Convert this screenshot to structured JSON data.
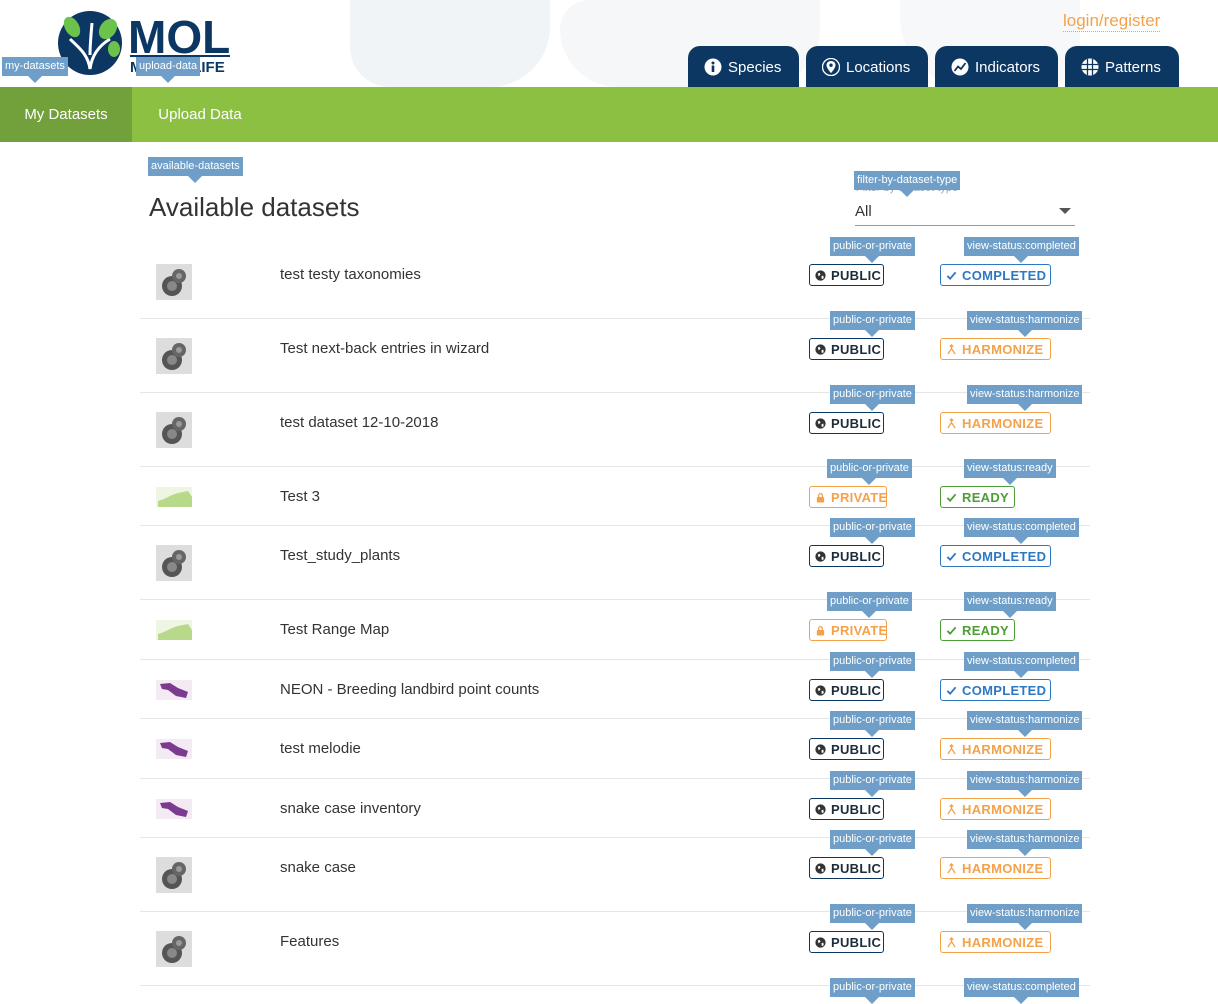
{
  "colors": {
    "nav_bg": "#0c3763",
    "green_bar": "#8cc043",
    "green_active": "#72a03a",
    "accent_orange": "#f4a24a",
    "tag_blue": "#6f9fc8"
  },
  "logo": {
    "text_top": "MOL",
    "text_bottom": "MAP OF LIFE"
  },
  "header": {
    "login_label": "login/register"
  },
  "nav": [
    {
      "label": "Species",
      "icon": "info-icon"
    },
    {
      "label": "Locations",
      "icon": "map-pin-icon"
    },
    {
      "label": "Indicators",
      "icon": "chart-icon"
    },
    {
      "label": "Patterns",
      "icon": "grid-globe-icon"
    }
  ],
  "subnav": {
    "my_datasets": "My Datasets",
    "upload_data": "Upload Data"
  },
  "tags": {
    "my_datasets": "my-datasets",
    "upload_data": "upload-data",
    "available": "available-datasets",
    "filter": "filter-by-dataset-type",
    "public_private": "public-or-private"
  },
  "page": {
    "title": "Available datasets"
  },
  "filter": {
    "label": "Filter by dataset type",
    "value": "All"
  },
  "datasets": [
    {
      "title": "test testy taxonomies",
      "thumb": "point-icon",
      "visibility": "PUBLIC",
      "status": "COMPLETED",
      "status_tag": "view-status:completed"
    },
    {
      "title": "Test next-back entries in wizard",
      "thumb": "point-icon",
      "visibility": "PUBLIC",
      "status": "HARMONIZE",
      "status_tag": "view-status:harmonize"
    },
    {
      "title": "test dataset 12-10-2018",
      "thumb": "point-icon",
      "visibility": "PUBLIC",
      "status": "HARMONIZE",
      "status_tag": "view-status:harmonize"
    },
    {
      "title": "Test 3",
      "thumb": "range-icon",
      "visibility": "PRIVATE",
      "status": "READY",
      "status_tag": "view-status:ready"
    },
    {
      "title": "Test_study_plants",
      "thumb": "point-icon",
      "visibility": "PUBLIC",
      "status": "COMPLETED",
      "status_tag": "view-status:completed"
    },
    {
      "title": "Test Range Map",
      "thumb": "range-icon",
      "visibility": "PRIVATE",
      "status": "READY",
      "status_tag": "view-status:ready"
    },
    {
      "title": "NEON - Breeding landbird point counts",
      "thumb": "inventory-icon",
      "visibility": "PUBLIC",
      "status": "COMPLETED",
      "status_tag": "view-status:completed"
    },
    {
      "title": "test melodie",
      "thumb": "inventory-icon",
      "visibility": "PUBLIC",
      "status": "HARMONIZE",
      "status_tag": "view-status:harmonize"
    },
    {
      "title": "snake case inventory",
      "thumb": "inventory-icon",
      "visibility": "PUBLIC",
      "status": "HARMONIZE",
      "status_tag": "view-status:harmonize"
    },
    {
      "title": "snake case",
      "thumb": "point-icon",
      "visibility": "PUBLIC",
      "status": "HARMONIZE",
      "status_tag": "view-status:harmonize"
    },
    {
      "title": "Features",
      "thumb": "point-icon",
      "visibility": "PUBLIC",
      "status": "HARMONIZE",
      "status_tag": "view-status:harmonize"
    }
  ],
  "trailing_tags": {
    "public_private": "public-or-private",
    "status": "view-status:completed"
  }
}
